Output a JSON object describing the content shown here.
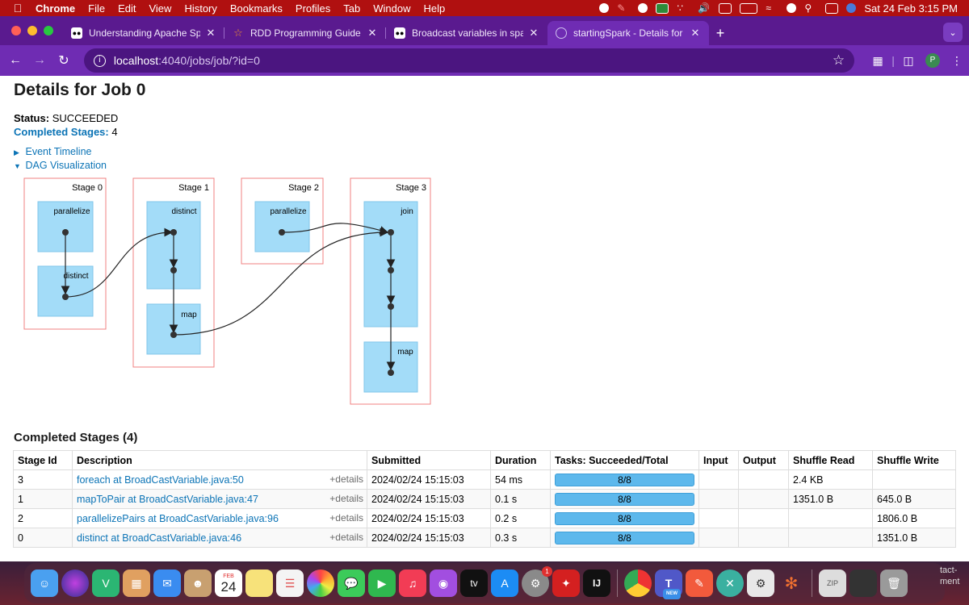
{
  "menubar": {
    "app": "Chrome",
    "items": [
      "File",
      "Edit",
      "View",
      "History",
      "Bookmarks",
      "Profiles",
      "Tab",
      "Window",
      "Help"
    ],
    "clock": "Sat 24 Feb  3:15 PM"
  },
  "tabs": [
    {
      "title": "Understanding Apache Spark",
      "favicon": "medium-icon"
    },
    {
      "title": "RDD Programming Guide - Sp",
      "favicon": "spark-star-icon"
    },
    {
      "title": "Broadcast variables in spark",
      "favicon": "medium-icon"
    },
    {
      "title": "startingSpark - Details for Job",
      "favicon": "globe-icon",
      "active": true
    }
  ],
  "toolbar": {
    "url_host": "localhost",
    "url_path": ":4040/jobs/job/?id=0",
    "profile_initial": "P"
  },
  "page": {
    "title": "Details for Job 0",
    "status_label": "Status:",
    "status_value": "SUCCEEDED",
    "completed_label": "Completed Stages:",
    "completed_value": "4",
    "event_timeline": "Event Timeline",
    "dag_visualization": "DAG Visualization"
  },
  "dag": {
    "stages": [
      {
        "label": "Stage 0",
        "ops": [
          "parallelize",
          "distinct"
        ]
      },
      {
        "label": "Stage 1",
        "ops": [
          "distinct",
          "map"
        ]
      },
      {
        "label": "Stage 2",
        "ops": [
          "parallelize"
        ]
      },
      {
        "label": "Stage 3",
        "ops": [
          "join",
          "map"
        ]
      }
    ]
  },
  "stages_table": {
    "title": "Completed Stages (4)",
    "columns": [
      "Stage Id",
      "Description",
      "Submitted",
      "Duration",
      "Tasks: Succeeded/Total",
      "Input",
      "Output",
      "Shuffle Read",
      "Shuffle Write"
    ],
    "details_label": "+details",
    "rows": [
      {
        "id": "3",
        "description": "foreach at BroadCastVariable.java:50",
        "submitted": "2024/02/24 15:15:03",
        "duration": "54 ms",
        "tasks": "8/8",
        "tasks_fraction": 1.0,
        "input": "",
        "output": "",
        "shuffle_read": "2.4 KB",
        "shuffle_write": ""
      },
      {
        "id": "1",
        "description": "mapToPair at BroadCastVariable.java:47",
        "submitted": "2024/02/24 15:15:03",
        "duration": "0.1 s",
        "tasks": "8/8",
        "tasks_fraction": 1.0,
        "input": "",
        "output": "",
        "shuffle_read": "1351.0 B",
        "shuffle_write": "645.0 B"
      },
      {
        "id": "2",
        "description": "parallelizePairs at BroadCastVariable.java:96",
        "submitted": "2024/02/24 15:15:03",
        "duration": "0.2 s",
        "tasks": "8/8",
        "tasks_fraction": 1.0,
        "input": "",
        "output": "",
        "shuffle_read": "",
        "shuffle_write": "1806.0 B"
      },
      {
        "id": "0",
        "description": "distinct at BroadCastVariable.java:46",
        "submitted": "2024/02/24 15:15:03",
        "duration": "0.3 s",
        "tasks": "8/8",
        "tasks_fraction": 1.0,
        "input": "",
        "output": "",
        "shuffle_read": "",
        "shuffle_write": "1351.0 B"
      }
    ]
  },
  "dock": {
    "calendar_month": "FEB",
    "calendar_day": "24",
    "tv_label": "tv",
    "intellij_label": "IJ",
    "teams_badge": "NEW",
    "app_store_badge": "1",
    "edge_text": "tact-\nment"
  },
  "colors": {
    "menubar": "#b01010",
    "tabstrip": "#5a1a8f",
    "toolbar": "#6f2cb3",
    "link": "#0c74b6",
    "stage_border": "#f08080",
    "op_fill": "#a3dcf8",
    "progress": "#5db8ec"
  }
}
